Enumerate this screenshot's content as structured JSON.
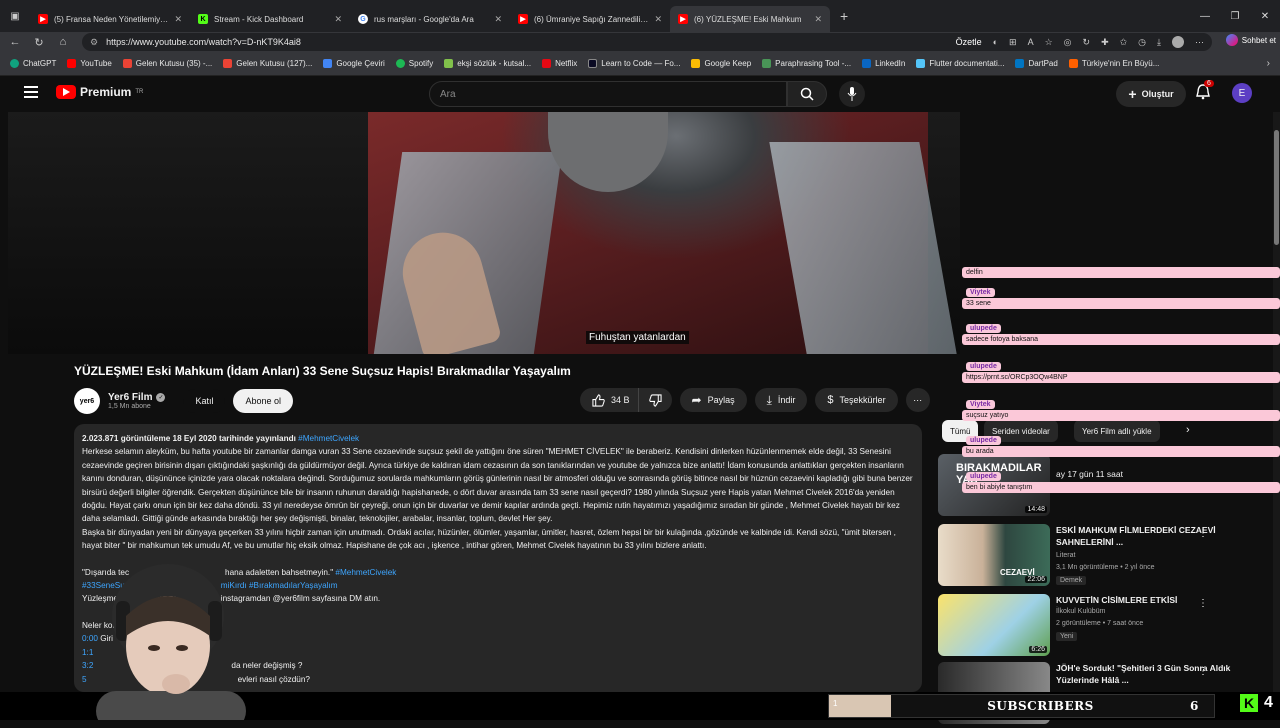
{
  "tabs": [
    {
      "title": "(5) Fransa Neden Yönetilemiyor?",
      "icon": "youtube-icon"
    },
    {
      "title": "Stream - Kick Dashboard",
      "icon": "kick-icon"
    },
    {
      "title": "rus marşları - Google'da Ara",
      "icon": "google-icon"
    },
    {
      "title": "(6) Ümraniye Sapığı Zannedilip Sa",
      "icon": "youtube-icon"
    },
    {
      "title": "(6) YÜZLEŞME! Eski Mahkum",
      "icon": "youtube-icon"
    }
  ],
  "address": {
    "url": "https://www.youtube.com/watch?v=D-nKT9K4ai8",
    "ozetle": "Özetle",
    "sohbet": "Sohbet et"
  },
  "bookmarks": [
    "ChatGPT",
    "YouTube",
    "Gelen Kutusu (35) -...",
    "Gelen Kutusu (127)...",
    "Google Çeviri",
    "Spotify",
    "ekşi sözlük - kutsal...",
    "Netflix",
    "Learn to Code — Fo...",
    "Google Keep",
    "Paraphrasing Tool -...",
    "LinkedIn",
    "Flutter documentati...",
    "DartPad",
    "Türkiye'nin En Büyü..."
  ],
  "yt": {
    "brand": "Premium",
    "tm": "TR",
    "search_placeholder": "Ara",
    "create": "Oluştur",
    "notif_count": "6",
    "avatar_letter": "E"
  },
  "video": {
    "subtitle": "Fuhuştan yatanlardan",
    "title": "YÜZLEŞME! Eski Mahkum (İdam Anları) 33 Sene Suçsuz Hapis! Bırakmadılar Yaşayalım",
    "channel": "Yer6 Film",
    "channel_logo": "yer6",
    "subs": "1,5 Mn abone",
    "join": "Katıl",
    "subscribe": "Abone ol",
    "likes": "34 B",
    "share": "Paylaş",
    "download": "İndir",
    "thanks": "Teşekkürler"
  },
  "description": {
    "meta": "2.023.871 görüntüleme  18 Eyl 2020 tarihinde yayınlandı",
    "tag": "#MehmetCivelek",
    "p1": "Herkese selamın aleyküm, bu hafta youtube bir zamanlar damga vuran 33 Sene cezaevinde suçsuz şekil de yattığını öne süren \"MEHMET CİVELEK\" ile beraberiz. Kendisini dinlerken hüzünlenmemek elde değil, 33 Senesini cezaevinde geçiren birisinin dışarı çıktığındaki şaşkınlığı da güldürmüyor değil. Ayrıca türkiye de kaldıran idam cezasının da son tanıklarından ve youtube de yalnızca bize anlattı! İdam konusunda anlattıkları gerçekten insanların kanını donduran, düşününce içinizde yara olacak noktalara değindi. Sorduğumuz sorularda mahkumların görüş günlerinin nasıl bir atmosferi olduğu ve sonrasında görüş bitince nasıl bir hüznün cezaevini kapladığı gibi buna benzer birsürü değerli bilgiler öğrendik. Gerçekten düşününce bile bir insanın ruhunun daraldığı hapishanede, o dört duvar arasında tam 33 sene nasıl geçerdi? 1980 yılında Suçsuz yere Hapis yatan Mehmet Civelek 2016'da yeniden doğdu. Hayat çarkı onun için bir kez daha döndü. 33 yıl neredeyse ömrün bir çeyreği, onun için bir duvarlar ve demir kapılar ardında geçti. Hepimiz rutin hayatımızı yaşadığımız sıradan bir günde , Mehmet Civelek hayatı bir kez daha selamladı. Gittiği günde arkasında bıraktığı her şey değişmişti, binalar, teknolojiler, arabalar, insanlar, toplum, devlet Her şey.",
    "p2": "Başka bir dünyadan yeni bir dünyaya geçerken 33 yılını hiçbir zaman için unutmadı. Ordaki acılar, hüzünler, ölümler, yaşamlar, ümitler, hasret, özlem hepsi bir bir kulağında ,gözünde ve kalbinde idi. Kendi sözü, \"ümit bitersen , hayat biter \" bir mahkumun tek umudu Af, ve bu umutlar hiç eksik olmaz. Hapishane de çok acı , işkence , intihar gören, Mehmet Civelek hayatının bu 33 yılını bizlere anlattı.",
    "q1": "\"Dışarıda tec",
    "q1b": "hana adaletten bahsetmeyin.\"",
    "q1tag": "#MehmetCivelek",
    "tags2a": "#33SeneSu",
    "tags2b": "miKırdı #BırakmadılarYaşayalım",
    "l3a": "Yüzleşme",
    "l3b": "e instagramdan @yer6film sayfasına DM atın.",
    "neler": "Neler konu",
    "t1": "0:00",
    "t1b": "Giri",
    "t2": "1:1",
    "t3": "3:2",
    "t3b": "da neler değişmiş ?",
    "t4": "5",
    "t4b": "evleri nasıl çözdün?"
  },
  "sidebar": {
    "chip_all": "Tümü",
    "chip_series": "Seriden videolar",
    "chip_channel": "Yer6 Film adlı yükle",
    "rec0_time": "ay 17 gün 11 saat",
    "rec0_dur": "14:48",
    "rec0_overlay": "BIRAKMADILAR YAŞ",
    "recs": [
      {
        "title": "ESKİ MAHKUM FİLMLERDEKİ CEZAEVİ SAHNELERİNİ ...",
        "channel": "Literat",
        "meta": "3,1 Mn görüntüleme • 2 yıl önce",
        "badge": "Demek",
        "dur": "22:06"
      },
      {
        "title": "KUVVETİN CİSİMLERE ETKİSİ",
        "channel": "İlkokul Kulübüm",
        "meta": "2 görüntüleme • 7 saat önce",
        "badge": "Yeni",
        "dur": "6:26"
      },
      {
        "title": "JÖH'e Sorduk! \"Şehitleri 3 Gün Sonra Aldık Yüzlerinde Hâlâ ...",
        "channel": "",
        "meta": "",
        "badge": "",
        "dur": ""
      }
    ]
  },
  "chat": [
    {
      "user": "",
      "msg": "delfin"
    },
    {
      "user": "Viytek",
      "msg": "33 sene"
    },
    {
      "user": "ulupede",
      "msg": "sadece fotoya baksana"
    },
    {
      "user": "ulupede",
      "msg": "https://prnt.sc/ORCp3OQw4BNP"
    },
    {
      "user": "Viytek",
      "msg": "suçsuz yatıyo"
    },
    {
      "user": "ulupede",
      "msg": "bu arada"
    },
    {
      "user": "ulupede",
      "msg": "ben bi abiyle tanıştım"
    }
  ],
  "overlay": {
    "progress": "1",
    "subs_label": "SUBSCRIBERS",
    "subs_count": "6",
    "kick_viewers": "4"
  },
  "colors": {
    "accent": "#3ea6ff",
    "brand": "#ff0000",
    "kick": "#53fc18",
    "chat_bg": "#fbc8d8"
  }
}
